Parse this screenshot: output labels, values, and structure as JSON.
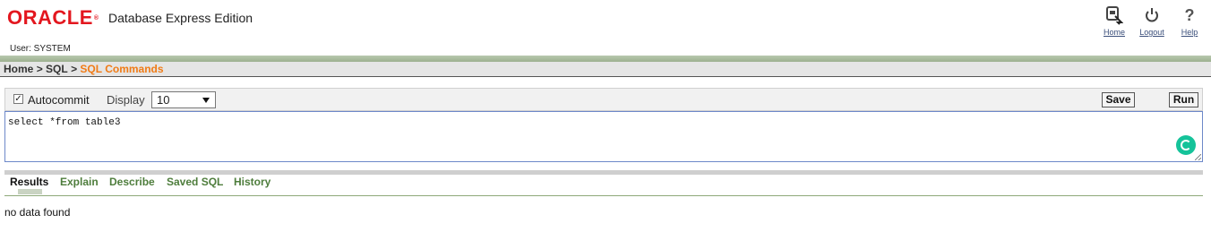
{
  "header": {
    "logo_text": "ORACLE",
    "logo_mark": "®",
    "product_name": "Database Express Edition",
    "user_label": "User: SYSTEM",
    "nav": [
      {
        "label": "Home",
        "icon": "home-icon"
      },
      {
        "label": "Logout",
        "icon": "power-icon"
      },
      {
        "label": "Help",
        "icon": "help-icon"
      }
    ]
  },
  "breadcrumb": {
    "items": [
      "Home",
      "SQL",
      "SQL Commands"
    ],
    "separator": ">"
  },
  "toolbar": {
    "autocommit_label": "Autocommit",
    "autocommit_checked": true,
    "display_label": "Display",
    "display_value": "10",
    "save_label": "Save",
    "run_label": "Run"
  },
  "editor": {
    "sql": "select *from table3"
  },
  "tabs": {
    "items": [
      "Results",
      "Explain",
      "Describe",
      "Saved SQL",
      "History"
    ],
    "active": "Results"
  },
  "results": {
    "message": "no data found"
  },
  "colors": {
    "brand": "#e3171f",
    "breadcrumb_current": "#f07b16",
    "tab_link": "#4e7d3c",
    "green_bar": "#9db090"
  }
}
